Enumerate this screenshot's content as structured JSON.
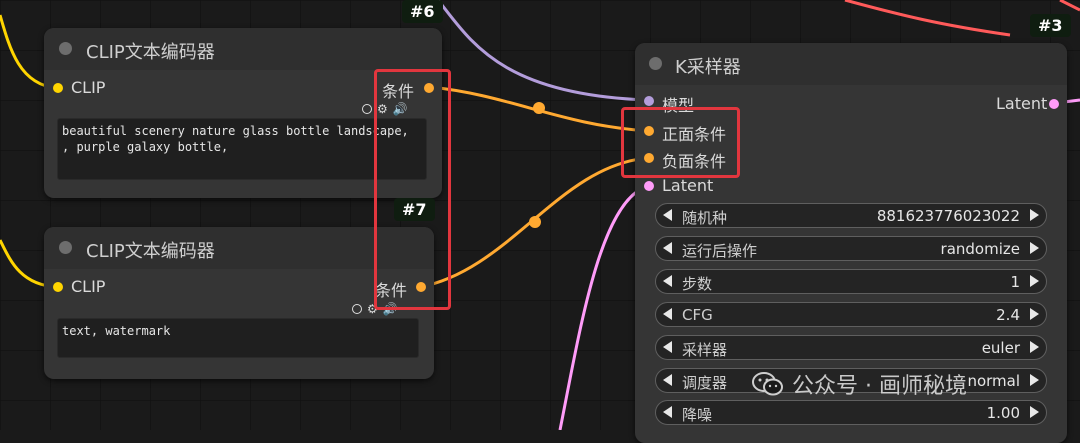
{
  "nodes": {
    "clip_encoder_top": {
      "id_badge": "#6",
      "title": "CLIP文本编码器",
      "input_label": "CLIP",
      "output_label": "条件",
      "prompt_text": "beautiful scenery nature glass bottle landscape,\n, purple galaxy bottle,"
    },
    "clip_encoder_bottom": {
      "id_badge": "#7",
      "title": "CLIP文本编码器",
      "input_label": "CLIP",
      "output_label": "条件",
      "prompt_text": "text, watermark"
    },
    "ksampler": {
      "id_badge": "#3",
      "title": "K采样器",
      "inputs": [
        "模型",
        "正面条件",
        "负面条件",
        "Latent"
      ],
      "output_label": "Latent",
      "widgets": [
        {
          "name": "随机种",
          "value": "881623776023022"
        },
        {
          "name": "运行后操作",
          "value": "randomize"
        },
        {
          "name": "步数",
          "value": "1"
        },
        {
          "name": "CFG",
          "value": "2.4"
        },
        {
          "name": "采样器",
          "value": "euler"
        },
        {
          "name": "调度器",
          "value": "normal"
        },
        {
          "name": "降噪",
          "value": "1.00"
        }
      ]
    }
  },
  "watermark": {
    "text": "公众号 · 画师秘境"
  },
  "colors": {
    "canvas_bg": "#1a1a1a",
    "node_bg": "#353535",
    "clip_slot": "#ffd500",
    "conditioning_slot": "#ffa931",
    "model_slot": "#b39ddb",
    "latent_slot": "#ff9cf9",
    "highlight": "#e2363e"
  },
  "icons": [
    "circle-toggle-icon",
    "gear-icon",
    "speaker-icon",
    "wechat-logo-icon"
  ]
}
